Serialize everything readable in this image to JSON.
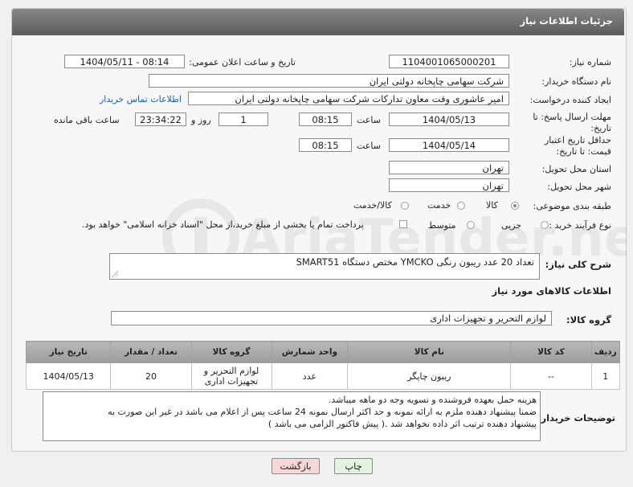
{
  "header": {
    "title": "جزئیات اطلاعات نیاز"
  },
  "fields": {
    "need_number_label": "شماره نیاز:",
    "need_number": "1104001065000201",
    "announce_label": "تاریخ و ساعت اعلان عمومی:",
    "announce_value": "1404/05/11 - 08:14",
    "buyer_org_label": "نام دستگاه خریدار:",
    "buyer_org": "شرکت سهامی چاپخانه دولتی ایران",
    "requester_label": "ایجاد کننده درخواست:",
    "requester": "امیر عاشوری وقت معاون تدارکات شرکت سهامی چاپخانه دولتی ایران",
    "contact_link": "اطلاعات تماس خریدار",
    "reply_deadline_label": "مهلت ارسال پاسخ: تا تاریخ:",
    "reply_date": "1404/05/13",
    "time_label": "ساعت",
    "reply_time": "08:15",
    "days_value": "1",
    "days_label": "روز و",
    "remaining_time": "23:34:22",
    "remaining_label": "ساعت باقی مانده",
    "min_validity_label": "حداقل تاریخ اعتبار قیمت: تا تاریخ:",
    "validity_date": "1404/05/14",
    "validity_time": "08:15",
    "province_label": "استان محل تحویل:",
    "province": "تهران",
    "city_label": "شهر محل تحویل:",
    "city": "تهران",
    "category_label": "طبقه بندی موضوعی:",
    "category_options": [
      "کالا",
      "خدمت",
      "کالا/خدمت"
    ],
    "process_label": "نوع فرآیند خرید :",
    "process_options": [
      "جزیی",
      "متوسط"
    ],
    "payment_note": "پرداخت تمام یا بخشی از مبلغ خرید،از محل \"اسناد خزانه اسلامی\" خواهد بود."
  },
  "description": {
    "label": "شرح کلی نیاز:",
    "value": "تعداد 20 عدد ریبون رنگی YMCKO مختص دستگاه SMART51"
  },
  "goods_section": {
    "title": "اطلاعات کالاهای مورد نیاز",
    "group_label": "گروه کالا:",
    "group_value": "لوازم التحریر و تجهیزات اداری"
  },
  "table": {
    "headers": [
      "ردیف",
      "کد کالا",
      "نام کالا",
      "واحد شمارش",
      "گروه کالا",
      "تعداد / مقدار",
      "تاریخ نیاز"
    ],
    "rows": [
      {
        "index": "1",
        "code": "--",
        "name": "ریبون چاپگر",
        "unit": "عدد",
        "group": "لوازم التحریر و تجهیزات اداری",
        "qty": "20",
        "date": "1404/05/13"
      }
    ]
  },
  "buyer_notes": {
    "label": "توضیحات خریدار:",
    "line1": "هزینه حمل بعهده فروشنده و تسویه وجه دو ماهه  میباشد.",
    "line2": "ضمنا پیشنهاد دهنده ملزم به ارائه نمونه و  حد اکثر ارسال نمونه 24 ساعت پس از اعلام می باشد در غیر این صورت به",
    "line3": "پیشنهاد دهنده ترتیب  اثر داده نخواهد شد .( پیش فاکتور الزامی می باشد )"
  },
  "buttons": {
    "print": "چاپ",
    "back": "بازگشت"
  },
  "watermark": {
    "text": "AriaTender.net"
  },
  "colors": {
    "header_bg": "#6e6e6e",
    "link": "#1a5fb4",
    "back_btn_bg": "#f7d8d8",
    "print_btn_bg": "#e3f3df"
  }
}
